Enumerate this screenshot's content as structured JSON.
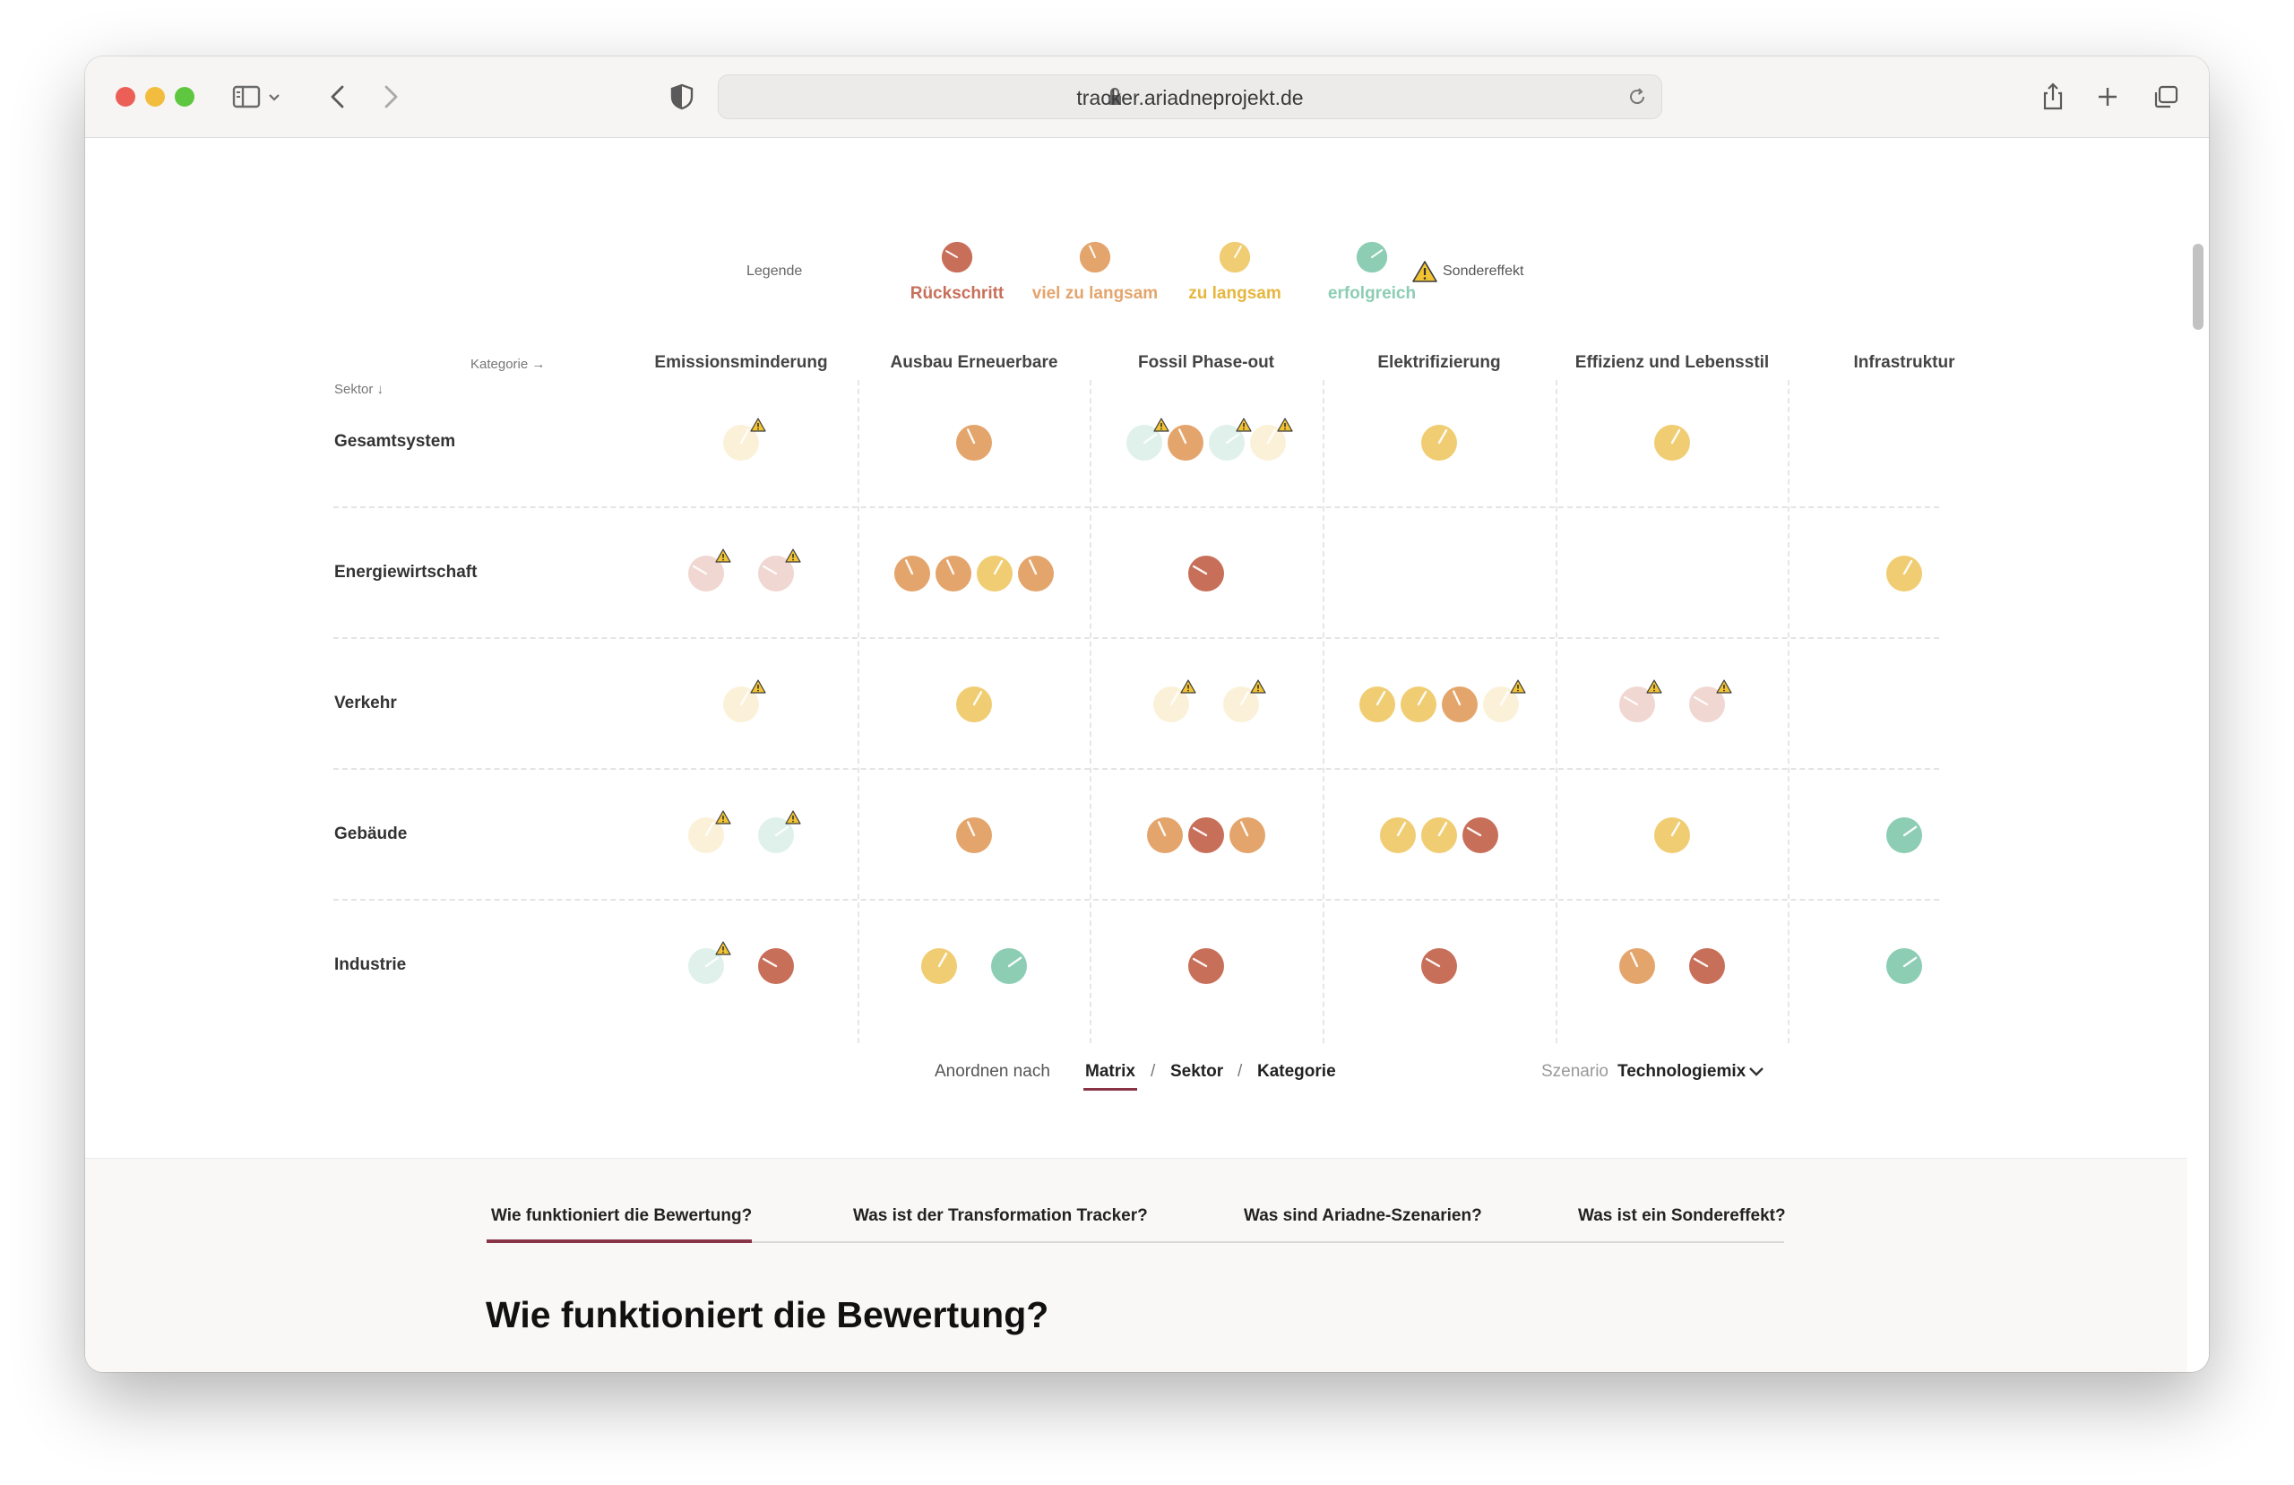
{
  "browser": {
    "url": "tracker.ariadneprojekt.de"
  },
  "legend": {
    "label": "Legende",
    "items": [
      {
        "name": "Rückschritt",
        "status": "rueckschritt"
      },
      {
        "name": "viel zu langsam",
        "status": "viel_zu_langsam"
      },
      {
        "name": "zu langsam",
        "status": "zu_langsam"
      },
      {
        "name": "erfolgreich",
        "status": "erfolgreich"
      }
    ],
    "special_label": "Sondereffekt"
  },
  "colors": {
    "rueckschritt": "#c86f5a",
    "viel_zu_langsam": "#e4a56c",
    "zu_langsam": "#f0cd73",
    "erfolgreich": "#8ccdb4",
    "accent": "#8a3447"
  },
  "matrix": {
    "kategorie_label": "Kategorie →",
    "sektor_label": "Sektor ↓",
    "categories": [
      "Emissionsminderung",
      "Ausbau Erneuerbare",
      "Fossil Phase-out",
      "Elektrifizierung",
      "Effizienz und Lebensstil",
      "Infrastruktur"
    ],
    "sectors": [
      "Gesamtsystem",
      "Energiewirtschaft",
      "Verkehr",
      "Gebäude",
      "Industrie"
    ],
    "cells": [
      [
        [
          {
            "s": "zu_langsam",
            "f": 1,
            "w": 1
          }
        ],
        [
          {
            "s": "viel_zu_langsam",
            "f": 0,
            "w": 0
          }
        ],
        [
          {
            "s": "erfolgreich",
            "f": 1,
            "w": 1
          },
          {
            "s": "viel_zu_langsam",
            "f": 0,
            "w": 0
          },
          {
            "s": "erfolgreich",
            "f": 1,
            "w": 1
          },
          {
            "s": "zu_langsam",
            "f": 1,
            "w": 1
          }
        ],
        [
          {
            "s": "zu_langsam",
            "f": 0,
            "w": 0
          }
        ],
        [
          {
            "s": "zu_langsam",
            "f": 0,
            "w": 0
          }
        ],
        []
      ],
      [
        [
          {
            "s": "rueckschritt",
            "f": 1,
            "w": 1
          },
          {
            "s": "rueckschritt",
            "f": 1,
            "w": 1
          }
        ],
        [
          {
            "s": "viel_zu_langsam",
            "f": 0,
            "w": 0
          },
          {
            "s": "viel_zu_langsam",
            "f": 0,
            "w": 0
          },
          {
            "s": "zu_langsam",
            "f": 0,
            "w": 0
          },
          {
            "s": "viel_zu_langsam",
            "f": 0,
            "w": 0
          }
        ],
        [
          {
            "s": "rueckschritt",
            "f": 0,
            "w": 0
          }
        ],
        [],
        [],
        [
          {
            "s": "zu_langsam",
            "f": 0,
            "w": 0
          }
        ]
      ],
      [
        [
          {
            "s": "zu_langsam",
            "f": 1,
            "w": 1
          }
        ],
        [
          {
            "s": "zu_langsam",
            "f": 0,
            "w": 0
          }
        ],
        [
          {
            "s": "zu_langsam",
            "f": 1,
            "w": 1
          },
          {
            "s": "zu_langsam",
            "f": 1,
            "w": 1
          }
        ],
        [
          {
            "s": "zu_langsam",
            "f": 0,
            "w": 0
          },
          {
            "s": "zu_langsam",
            "f": 0,
            "w": 0
          },
          {
            "s": "viel_zu_langsam",
            "f": 0,
            "w": 0
          },
          {
            "s": "zu_langsam",
            "f": 1,
            "w": 1
          }
        ],
        [
          {
            "s": "rueckschritt",
            "f": 1,
            "w": 1
          },
          {
            "s": "rueckschritt",
            "f": 1,
            "w": 1
          }
        ],
        []
      ],
      [
        [
          {
            "s": "zu_langsam",
            "f": 1,
            "w": 1
          },
          {
            "s": "erfolgreich",
            "f": 1,
            "w": 1
          }
        ],
        [
          {
            "s": "viel_zu_langsam",
            "f": 0,
            "w": 0
          }
        ],
        [
          {
            "s": "viel_zu_langsam",
            "f": 0,
            "w": 0
          },
          {
            "s": "rueckschritt",
            "f": 0,
            "w": 0
          },
          {
            "s": "viel_zu_langsam",
            "f": 0,
            "w": 0
          }
        ],
        [
          {
            "s": "zu_langsam",
            "f": 0,
            "w": 0
          },
          {
            "s": "zu_langsam",
            "f": 0,
            "w": 0
          },
          {
            "s": "rueckschritt",
            "f": 0,
            "w": 0
          }
        ],
        [
          {
            "s": "zu_langsam",
            "f": 0,
            "w": 0
          }
        ],
        [
          {
            "s": "erfolgreich",
            "f": 0,
            "w": 0
          }
        ]
      ],
      [
        [
          {
            "s": "erfolgreich",
            "f": 1,
            "w": 1
          },
          {
            "s": "rueckschritt",
            "f": 0,
            "w": 0
          }
        ],
        [
          {
            "s": "zu_langsam",
            "f": 0,
            "w": 0
          },
          {
            "s": "erfolgreich",
            "f": 0,
            "w": 0
          }
        ],
        [
          {
            "s": "rueckschritt",
            "f": 0,
            "w": 0
          }
        ],
        [
          {
            "s": "rueckschritt",
            "f": 0,
            "w": 0
          }
        ],
        [
          {
            "s": "viel_zu_langsam",
            "f": 0,
            "w": 0
          },
          {
            "s": "rueckschritt",
            "f": 0,
            "w": 0
          }
        ],
        [
          {
            "s": "erfolgreich",
            "f": 0,
            "w": 0
          }
        ]
      ]
    ]
  },
  "controls": {
    "arrange_label": "Anordnen nach",
    "options": [
      "Matrix",
      "Sektor",
      "Kategorie"
    ],
    "separator": "/",
    "active_option": "Matrix",
    "scenario_label": "Szenario",
    "scenario_value": "Technologiemix"
  },
  "faq": {
    "tabs": [
      "Wie funktioniert die Bewertung?",
      "Was ist der Transformation Tracker?",
      "Was sind Ariadne-Szenarien?",
      "Was ist ein Sondereffekt?"
    ],
    "active_tab": "Wie funktioniert die Bewertung?",
    "section_title": "Wie funktioniert die Bewertung?"
  }
}
